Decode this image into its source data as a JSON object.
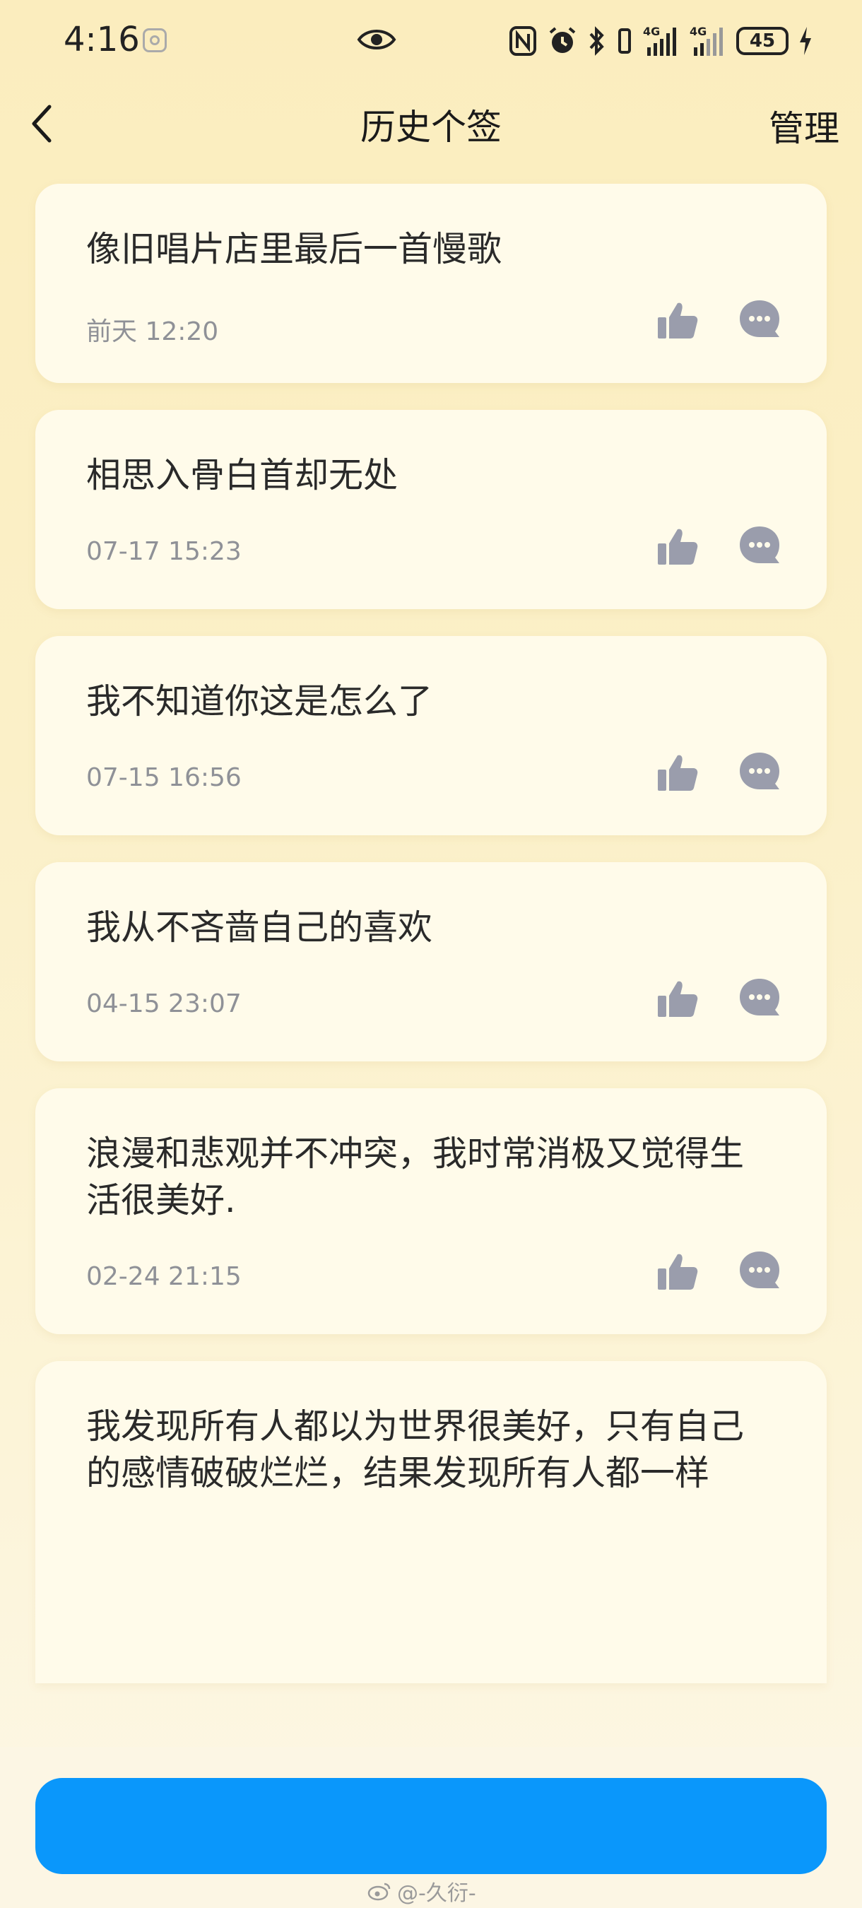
{
  "status_bar": {
    "time": "4:16",
    "network_1": "4G",
    "network_2": "4G",
    "battery": "45"
  },
  "nav": {
    "title": "历史个签",
    "manage": "管理"
  },
  "signatures": [
    {
      "text": "像旧唱片店里最后一首慢歌",
      "time": "前天 12:20"
    },
    {
      "text": "相思入骨白首却无处",
      "time": "07-17 15:23"
    },
    {
      "text": "我不知道你这是怎么了",
      "time": "07-15 16:56"
    },
    {
      "text": "我从不吝啬自己的喜欢",
      "time": "04-15 23:07"
    },
    {
      "text": "浪漫和悲观并不冲突，我时常消极又觉得生活很美好.",
      "time": "02-24 21:15"
    },
    {
      "text": "我发现所有人都以为世界很美好，只有自己的感情破破烂烂，结果发现所有人都一样",
      "time": ""
    }
  ],
  "watermark": "@-久衍-",
  "colors": {
    "primary_button": "#0a97fb",
    "card_bg": "#fffbea",
    "icon_gray": "#9a9dac"
  },
  "icons": [
    "eye-icon",
    "back-chevron-icon",
    "thumbs-up-icon",
    "comment-bubble-icon"
  ]
}
